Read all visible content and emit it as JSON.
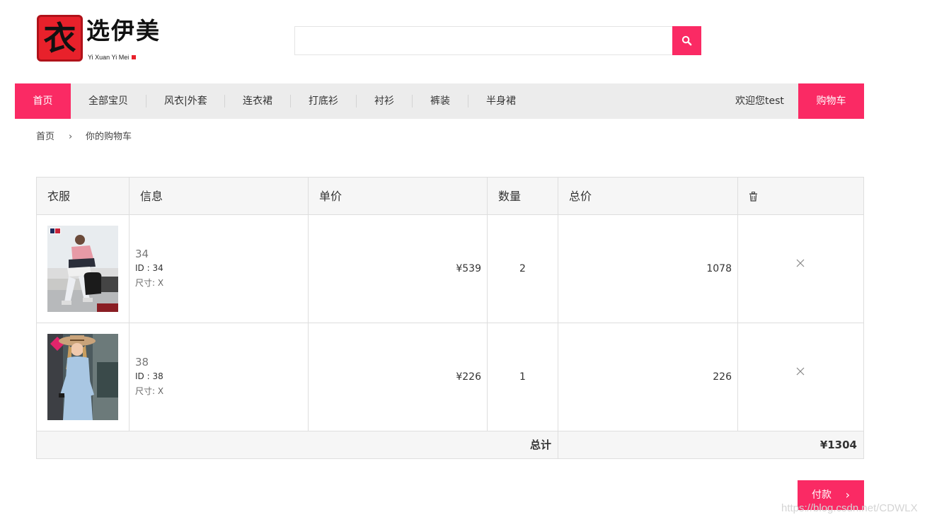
{
  "logo": {
    "char": "衣",
    "name": "选伊美",
    "subtitle": "Yi Xuan Yi Mei"
  },
  "search": {
    "value": "",
    "placeholder": ""
  },
  "nav": {
    "items": [
      "首页",
      "全部宝贝",
      "风衣|外套",
      "连衣裙",
      "打底衫",
      "衬衫",
      "裤装",
      "半身裙"
    ],
    "welcome": "欢迎您test",
    "cart": "购物车"
  },
  "breadcrumb": {
    "home": "首页",
    "separator": "›",
    "current": "你的购物车"
  },
  "table": {
    "headers": {
      "clothes": "衣服",
      "info": "信息",
      "unit_price": "单价",
      "quantity": "数量",
      "total": "总价"
    },
    "rows": [
      {
        "name": "34",
        "id": "ID : 34",
        "size": "尺寸: X",
        "price": "¥539",
        "qty": "2",
        "total": "1078"
      },
      {
        "name": "38",
        "id": "ID : 38",
        "size": "尺寸: X",
        "price": "¥226",
        "qty": "1",
        "total": "226"
      }
    ],
    "footer": {
      "label": "总计",
      "amount": "¥1304"
    }
  },
  "pay": {
    "label": "付款",
    "chevron": "›"
  },
  "watermark": "https://blog.csdn.net/CDWLX",
  "icons": {
    "search": "search-icon",
    "trash": "trash-icon",
    "remove": "close-icon"
  },
  "colors": {
    "accent": "#fa2a64",
    "logo_red": "#e8212b",
    "nav_bg": "#ececec",
    "header_bg": "#f6f6f6",
    "border": "#dedede"
  }
}
